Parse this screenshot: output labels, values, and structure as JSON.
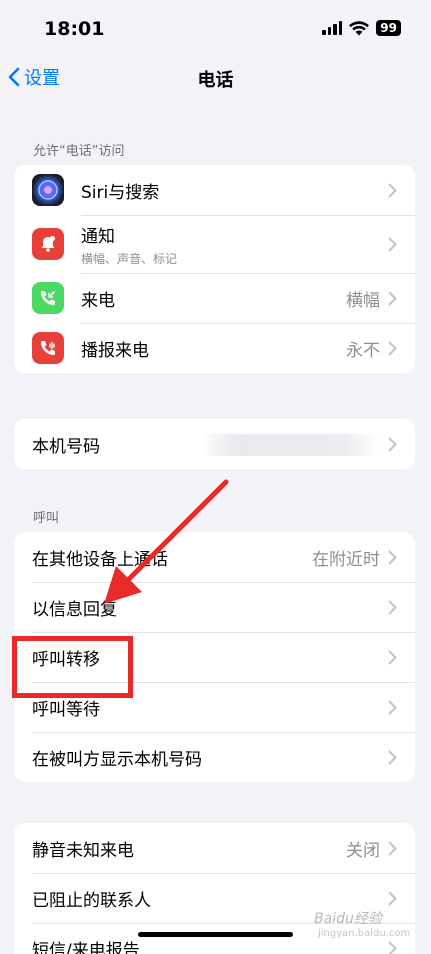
{
  "status_bar": {
    "time": "18:01",
    "battery": "99"
  },
  "nav": {
    "back_label": "设置",
    "title": "电话"
  },
  "sections": {
    "allow_access_header": "允许“电话”访问",
    "calls_header": "呼叫"
  },
  "access_items": [
    {
      "label": "Siri与搜索",
      "subtitle": "",
      "value": "",
      "icon": "siri-icon",
      "color": "#1f1f2e"
    },
    {
      "label": "通知",
      "subtitle": "横幅、声音、标记",
      "value": "",
      "icon": "notification-bell-icon",
      "color": "#e8413c"
    },
    {
      "label": "来电",
      "subtitle": "",
      "value": "横幅",
      "icon": "incoming-call-icon",
      "color": "#4cd964"
    },
    {
      "label": "播报来电",
      "subtitle": "",
      "value": "永不",
      "icon": "announce-call-icon",
      "color": "#e8413c"
    }
  ],
  "my_number": {
    "label": "本机号码"
  },
  "call_items": [
    {
      "label": "在其他设备上通话",
      "value": "在附近时"
    },
    {
      "label": "以信息回复",
      "value": ""
    },
    {
      "label": "呼叫转移",
      "value": ""
    },
    {
      "label": "呼叫等待",
      "value": ""
    },
    {
      "label": "在被叫方显示本机号码",
      "value": ""
    }
  ],
  "other_items": [
    {
      "label": "静音未知来电",
      "value": "关闭"
    },
    {
      "label": "已阻止的联系人",
      "value": ""
    },
    {
      "label": "短信/来电报告",
      "value": ""
    }
  ],
  "watermark": {
    "brand": "Baidu经验",
    "url": "jingyan.baidu.com"
  },
  "colors": {
    "accent": "#007aff",
    "annotation": "#e82a2a"
  }
}
